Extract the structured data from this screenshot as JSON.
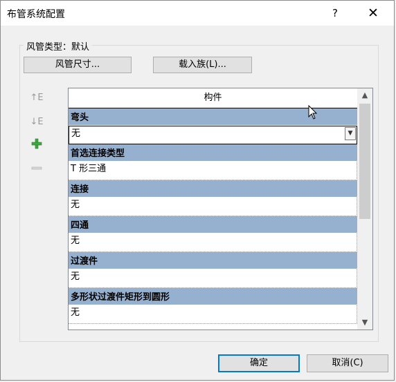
{
  "dialog": {
    "title": "布管系统配置",
    "help_label": "?",
    "close_label": "✕"
  },
  "group": {
    "title": "风管类型：默认"
  },
  "buttons": {
    "duct_size": "风管尺寸...",
    "load_family": "载入族(L)...",
    "ok": "确定",
    "cancel": "取消(C)"
  },
  "side_tools": {
    "move_up": "↑E",
    "move_down": "↓E",
    "add": "+",
    "remove": "—"
  },
  "grid": {
    "column_header": "构件",
    "sections": [
      {
        "header": "弯头",
        "value": "无"
      },
      {
        "header": "首选连接类型",
        "value": "T 形三通"
      },
      {
        "header": "连接",
        "value": "无"
      },
      {
        "header": "四通",
        "value": "无"
      },
      {
        "header": "过渡件",
        "value": "无"
      },
      {
        "header": "多形状过渡件矩形到圆形",
        "value": "无"
      }
    ]
  }
}
